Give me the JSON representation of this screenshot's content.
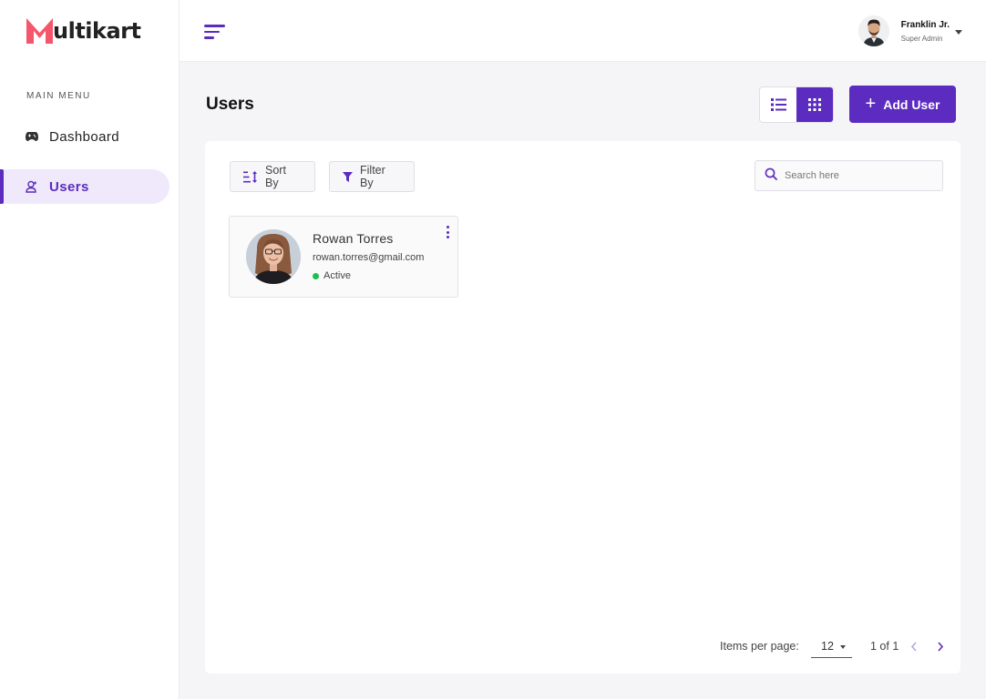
{
  "brand": {
    "logo_text": "ultikart",
    "accent_color": "#5c2bc0",
    "logo_color": "#f4576b"
  },
  "sidebar": {
    "menu_title": "MAIN MENU",
    "items": [
      {
        "label": "Dashboard",
        "icon": "gamepad-icon",
        "active": false
      },
      {
        "label": "Users",
        "icon": "user-icon",
        "active": true
      }
    ]
  },
  "header": {
    "user_name": "Franklin Jr.",
    "user_role": "Super Admin"
  },
  "main": {
    "title": "Users",
    "view_modes": [
      "list",
      "grid"
    ],
    "active_view": "grid",
    "add_button_label": "Add User",
    "toolbar": {
      "sort_label": "Sort By",
      "filter_label": "Filter By",
      "search_placeholder": "Search here"
    },
    "users": [
      {
        "name": "Rowan Torres",
        "email": "rowan.torres@gmail.com",
        "status": "Active",
        "status_color": "#1fbf4e"
      }
    ],
    "pagination": {
      "items_per_page_label": "Items per page:",
      "items_per_page": "12",
      "range_text": "1 of 1"
    }
  }
}
